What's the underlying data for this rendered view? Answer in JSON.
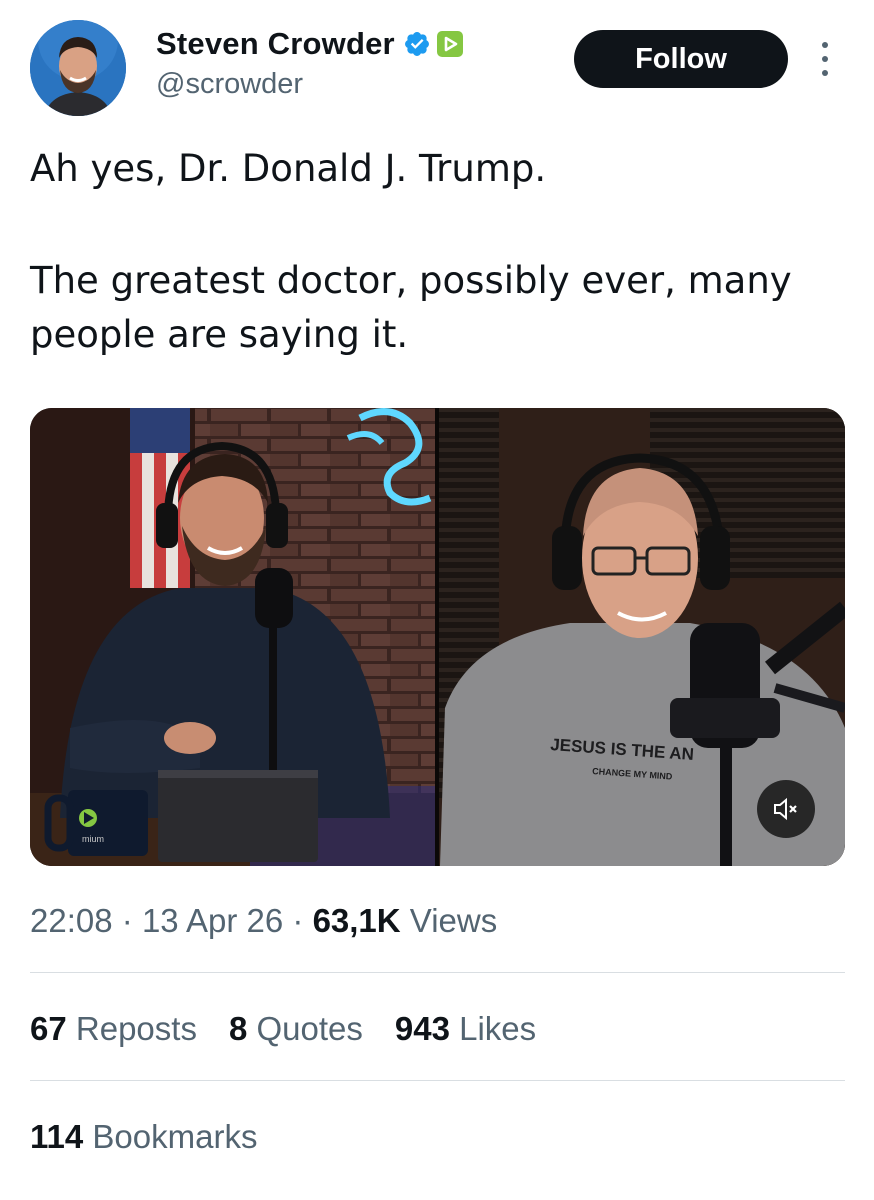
{
  "author": {
    "display_name": "Steven Crowder",
    "handle": "@scrowder",
    "verified_badge_icon": "verified-badge-icon",
    "rumble_badge_icon": "rumble-badge-icon",
    "avatar_icon": "avatar-image"
  },
  "header": {
    "follow_label": "Follow",
    "more_icon": "more-options-icon"
  },
  "tweet": {
    "line1": "Ah yes, Dr. Donald J. Trump.",
    "line2": "The greatest doctor, possibly ever, many people are saying it."
  },
  "media": {
    "shirt_text_1": "JESUS IS THE AN",
    "shirt_text_2": "CHANGE MY MIND",
    "mug_text": "mium",
    "mute_icon": "muted-speaker-icon"
  },
  "meta": {
    "time": "22:08",
    "date": "13 Apr 26",
    "views_count": "63,1K",
    "views_label": "Views"
  },
  "stats": {
    "reposts_count": "67",
    "reposts_label": "Reposts",
    "quotes_count": "8",
    "quotes_label": "Quotes",
    "likes_count": "943",
    "likes_label": "Likes",
    "bookmarks_count": "114",
    "bookmarks_label": "Bookmarks"
  },
  "colors": {
    "text_primary": "#0f1419",
    "text_secondary": "#536471",
    "verified_blue": "#1d9bf0",
    "rumble_green": "#85c742",
    "follow_button_bg": "#0f1419"
  }
}
